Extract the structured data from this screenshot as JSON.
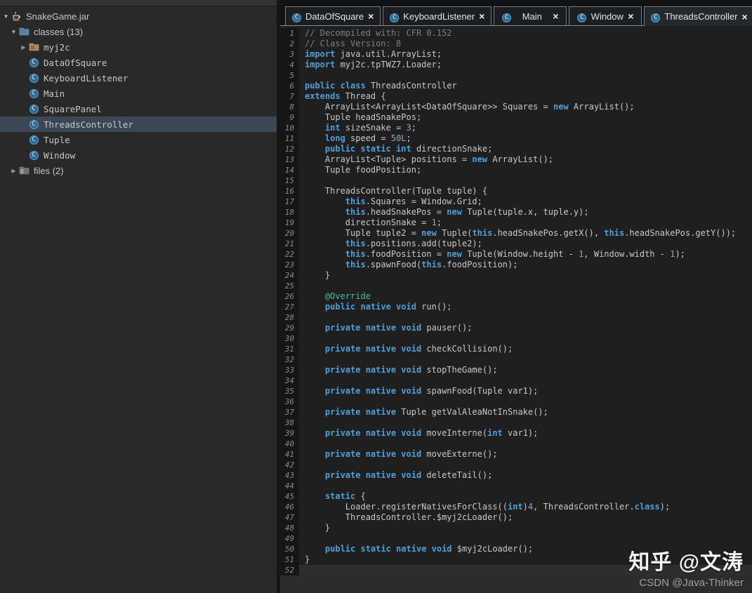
{
  "sidebar": {
    "items": [
      {
        "label": "SnakeGame.jar",
        "icon": "java-jar-icon",
        "arrow": "down",
        "indent": 0,
        "mono": false,
        "selected": false
      },
      {
        "label": "classes (13)",
        "icon": "folder-blue-icon",
        "arrow": "down",
        "indent": 1,
        "mono": false,
        "selected": false
      },
      {
        "label": "myj2c",
        "icon": "folder-tan-icon",
        "arrow": "right",
        "indent": 2,
        "mono": true,
        "selected": false
      },
      {
        "label": "DataOfSquare",
        "icon": "class-icon",
        "arrow": null,
        "indent": 2,
        "mono": true,
        "selected": false
      },
      {
        "label": "KeyboardListener",
        "icon": "class-icon",
        "arrow": null,
        "indent": 2,
        "mono": true,
        "selected": false
      },
      {
        "label": "Main",
        "icon": "class-icon",
        "arrow": null,
        "indent": 2,
        "mono": true,
        "selected": false
      },
      {
        "label": "SquarePanel",
        "icon": "class-icon",
        "arrow": null,
        "indent": 2,
        "mono": true,
        "selected": false
      },
      {
        "label": "ThreadsController",
        "icon": "class-icon",
        "arrow": null,
        "indent": 2,
        "mono": true,
        "selected": true
      },
      {
        "label": "Tuple",
        "icon": "class-icon",
        "arrow": null,
        "indent": 2,
        "mono": true,
        "selected": false
      },
      {
        "label": "Window",
        "icon": "class-icon",
        "arrow": null,
        "indent": 2,
        "mono": true,
        "selected": false
      },
      {
        "label": "files (2)",
        "icon": "folder-gray-icon",
        "arrow": "right",
        "indent": 1,
        "mono": false,
        "selected": false
      }
    ]
  },
  "tabs": [
    {
      "label": "DataOfSquare",
      "close": "×",
      "active": false,
      "wide": false
    },
    {
      "label": "KeyboardListener",
      "close": "×",
      "active": false,
      "wide": false
    },
    {
      "label": "Main",
      "close": "×",
      "active": false,
      "wide": true
    },
    {
      "label": "Window",
      "close": "×",
      "active": false,
      "wide": true
    },
    {
      "label": "ThreadsController",
      "close": "×",
      "active": true,
      "wide": false
    }
  ],
  "editor": {
    "current_line": 52,
    "lines": [
      {
        "n": 1,
        "segs": [
          [
            "cm",
            "// Decompiled with: CFR 0.152"
          ]
        ]
      },
      {
        "n": 2,
        "segs": [
          [
            "cm",
            "// Class Version: 8"
          ]
        ]
      },
      {
        "n": 3,
        "segs": [
          [
            "kw",
            "import"
          ],
          [
            "pl",
            " java.util.ArrayList;"
          ]
        ]
      },
      {
        "n": 4,
        "segs": [
          [
            "kw",
            "import"
          ],
          [
            "pl",
            " myj2c.tpTWZ7.Loader;"
          ]
        ]
      },
      {
        "n": 5,
        "segs": []
      },
      {
        "n": 6,
        "segs": [
          [
            "kw",
            "public class"
          ],
          [
            "pl",
            " ThreadsController"
          ]
        ]
      },
      {
        "n": 7,
        "segs": [
          [
            "kw",
            "extends"
          ],
          [
            "pl",
            " Thread {"
          ]
        ]
      },
      {
        "n": 8,
        "segs": [
          [
            "pl",
            "    ArrayList<ArrayList<DataOfSquare>> Squares = "
          ],
          [
            "kw",
            "new"
          ],
          [
            "pl",
            " ArrayList();"
          ]
        ]
      },
      {
        "n": 9,
        "segs": [
          [
            "pl",
            "    Tuple headSnakePos;"
          ]
        ]
      },
      {
        "n": 10,
        "segs": [
          [
            "pl",
            "    "
          ],
          [
            "kw",
            "int"
          ],
          [
            "pl",
            " sizeSnake = "
          ],
          [
            "nu",
            "3"
          ],
          [
            "pl",
            ";"
          ]
        ]
      },
      {
        "n": 11,
        "segs": [
          [
            "pl",
            "    "
          ],
          [
            "kw",
            "long"
          ],
          [
            "pl",
            " speed = "
          ],
          [
            "nu",
            "50L"
          ],
          [
            "pl",
            ";"
          ]
        ]
      },
      {
        "n": 12,
        "segs": [
          [
            "pl",
            "    "
          ],
          [
            "kw",
            "public static int"
          ],
          [
            "pl",
            " directionSnake;"
          ]
        ]
      },
      {
        "n": 13,
        "segs": [
          [
            "pl",
            "    ArrayList<Tuple> positions = "
          ],
          [
            "kw",
            "new"
          ],
          [
            "pl",
            " ArrayList();"
          ]
        ]
      },
      {
        "n": 14,
        "segs": [
          [
            "pl",
            "    Tuple foodPosition;"
          ]
        ]
      },
      {
        "n": 15,
        "segs": []
      },
      {
        "n": 16,
        "segs": [
          [
            "pl",
            "    ThreadsController(Tuple tuple) {"
          ]
        ]
      },
      {
        "n": 17,
        "segs": [
          [
            "pl",
            "        "
          ],
          [
            "kw",
            "this"
          ],
          [
            "pl",
            ".Squares = Window.Grid;"
          ]
        ]
      },
      {
        "n": 18,
        "segs": [
          [
            "pl",
            "        "
          ],
          [
            "kw",
            "this"
          ],
          [
            "pl",
            ".headSnakePos = "
          ],
          [
            "kw",
            "new"
          ],
          [
            "pl",
            " Tuple(tuple.x, tuple.y);"
          ]
        ]
      },
      {
        "n": 19,
        "segs": [
          [
            "pl",
            "        directionSnake = "
          ],
          [
            "nu",
            "1"
          ],
          [
            "pl",
            ";"
          ]
        ]
      },
      {
        "n": 20,
        "segs": [
          [
            "pl",
            "        Tuple tuple2 = "
          ],
          [
            "kw",
            "new"
          ],
          [
            "pl",
            " Tuple("
          ],
          [
            "kw",
            "this"
          ],
          [
            "pl",
            ".headSnakePos.getX(), "
          ],
          [
            "kw",
            "this"
          ],
          [
            "pl",
            ".headSnakePos.getY());"
          ]
        ]
      },
      {
        "n": 21,
        "segs": [
          [
            "pl",
            "        "
          ],
          [
            "kw",
            "this"
          ],
          [
            "pl",
            ".positions.add(tuple2);"
          ]
        ]
      },
      {
        "n": 22,
        "segs": [
          [
            "pl",
            "        "
          ],
          [
            "kw",
            "this"
          ],
          [
            "pl",
            ".foodPosition = "
          ],
          [
            "kw",
            "new"
          ],
          [
            "pl",
            " Tuple(Window.height - "
          ],
          [
            "nu",
            "1"
          ],
          [
            "pl",
            ", Window.width - "
          ],
          [
            "nu",
            "1"
          ],
          [
            "pl",
            ");"
          ]
        ]
      },
      {
        "n": 23,
        "segs": [
          [
            "pl",
            "        "
          ],
          [
            "kw",
            "this"
          ],
          [
            "pl",
            ".spawnFood("
          ],
          [
            "kw",
            "this"
          ],
          [
            "pl",
            ".foodPosition);"
          ]
        ]
      },
      {
        "n": 24,
        "segs": [
          [
            "pl",
            "    }"
          ]
        ]
      },
      {
        "n": 25,
        "segs": []
      },
      {
        "n": 26,
        "segs": [
          [
            "pl",
            "    "
          ],
          [
            "an",
            "@Override"
          ]
        ]
      },
      {
        "n": 27,
        "segs": [
          [
            "pl",
            "    "
          ],
          [
            "kw",
            "public native void"
          ],
          [
            "pl",
            " run();"
          ]
        ]
      },
      {
        "n": 28,
        "segs": []
      },
      {
        "n": 29,
        "segs": [
          [
            "pl",
            "    "
          ],
          [
            "kw",
            "private native void"
          ],
          [
            "pl",
            " pauser();"
          ]
        ]
      },
      {
        "n": 30,
        "segs": []
      },
      {
        "n": 31,
        "segs": [
          [
            "pl",
            "    "
          ],
          [
            "kw",
            "private native void"
          ],
          [
            "pl",
            " checkCollision();"
          ]
        ]
      },
      {
        "n": 32,
        "segs": []
      },
      {
        "n": 33,
        "segs": [
          [
            "pl",
            "    "
          ],
          [
            "kw",
            "private native void"
          ],
          [
            "pl",
            " stopTheGame();"
          ]
        ]
      },
      {
        "n": 34,
        "segs": []
      },
      {
        "n": 35,
        "segs": [
          [
            "pl",
            "    "
          ],
          [
            "kw",
            "private native void"
          ],
          [
            "pl",
            " spawnFood(Tuple var1);"
          ]
        ]
      },
      {
        "n": 36,
        "segs": []
      },
      {
        "n": 37,
        "segs": [
          [
            "pl",
            "    "
          ],
          [
            "kw",
            "private native"
          ],
          [
            "pl",
            " Tuple getValAleaNotInSnake();"
          ]
        ]
      },
      {
        "n": 38,
        "segs": []
      },
      {
        "n": 39,
        "segs": [
          [
            "pl",
            "    "
          ],
          [
            "kw",
            "private native void"
          ],
          [
            "pl",
            " moveInterne("
          ],
          [
            "kw",
            "int"
          ],
          [
            "pl",
            " var1);"
          ]
        ]
      },
      {
        "n": 40,
        "segs": []
      },
      {
        "n": 41,
        "segs": [
          [
            "pl",
            "    "
          ],
          [
            "kw",
            "private native void"
          ],
          [
            "pl",
            " moveExterne();"
          ]
        ]
      },
      {
        "n": 42,
        "segs": []
      },
      {
        "n": 43,
        "segs": [
          [
            "pl",
            "    "
          ],
          [
            "kw",
            "private native void"
          ],
          [
            "pl",
            " deleteTail();"
          ]
        ]
      },
      {
        "n": 44,
        "segs": []
      },
      {
        "n": 45,
        "segs": [
          [
            "pl",
            "    "
          ],
          [
            "kw",
            "static"
          ],
          [
            "pl",
            " {"
          ]
        ]
      },
      {
        "n": 46,
        "segs": [
          [
            "pl",
            "        Loader.registerNativesForClass(("
          ],
          [
            "kw",
            "int"
          ],
          [
            "pl",
            ")"
          ],
          [
            "nu",
            "4"
          ],
          [
            "pl",
            ", ThreadsController."
          ],
          [
            "kw",
            "class"
          ],
          [
            "pl",
            ");"
          ]
        ]
      },
      {
        "n": 47,
        "segs": [
          [
            "pl",
            "        ThreadsController.$myj2cLoader();"
          ]
        ]
      },
      {
        "n": 48,
        "segs": [
          [
            "pl",
            "    }"
          ]
        ]
      },
      {
        "n": 49,
        "segs": []
      },
      {
        "n": 50,
        "segs": [
          [
            "pl",
            "    "
          ],
          [
            "kw",
            "public static native void"
          ],
          [
            "pl",
            " $myj2cLoader();"
          ]
        ]
      },
      {
        "n": 51,
        "segs": [
          [
            "pl",
            "}"
          ]
        ]
      },
      {
        "n": 52,
        "segs": []
      }
    ]
  },
  "watermark": {
    "primary": "知乎 @文涛",
    "secondary": "CSDN @Java-Thinker"
  },
  "colors": {
    "keyword_blue": "#4f9fd8",
    "annotation_teal": "#3fbf9f",
    "comment_gray": "#7d7d7d",
    "editor_bg": "#1f1f1f",
    "tree_selection": "#3b4754",
    "class_icon_blue": "#2e6c95"
  }
}
